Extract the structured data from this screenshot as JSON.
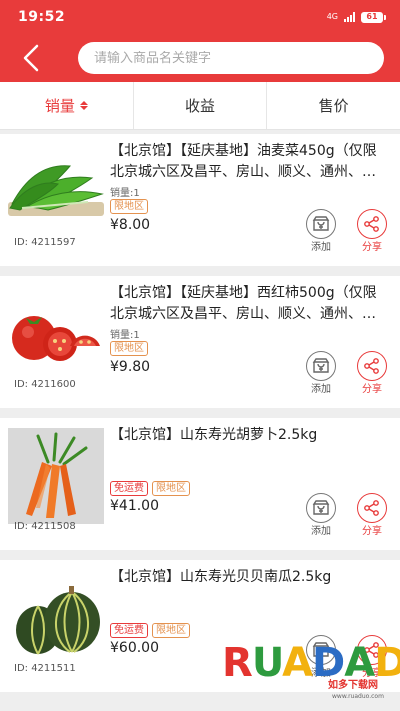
{
  "status_bar": {
    "time": "19:52",
    "network": "4G",
    "battery": "61"
  },
  "header": {
    "search_placeholder": "请输入商品名关键字"
  },
  "sort_tabs": [
    {
      "label": "销量",
      "active": true
    },
    {
      "label": "收益",
      "active": false
    },
    {
      "label": "售价",
      "active": false
    }
  ],
  "products": [
    {
      "title": "【北京馆】【延庆基地】油麦菜450g（仅限北京城六区及昌平、房山、顺义、通州、…",
      "sales": "销量:1",
      "tags": [
        "限地区"
      ],
      "price": "¥8.00",
      "id": "ID: 4211597",
      "image": "lettuce",
      "add_label": "添加",
      "share_label": "分享"
    },
    {
      "title": "【北京馆】【延庆基地】西红柿500g（仅限北京城六区及昌平、房山、顺义、通州、…",
      "sales": "销量:1",
      "tags": [
        "限地区"
      ],
      "price": "¥9.80",
      "id": "ID: 4211600",
      "image": "tomato",
      "add_label": "添加",
      "share_label": "分享"
    },
    {
      "title": "【北京馆】山东寿光胡萝卜2.5kg",
      "sales": "",
      "tags": [
        "免运费",
        "限地区"
      ],
      "price": "¥41.00",
      "id": "ID: 4211508",
      "image": "carrot",
      "add_label": "添加",
      "share_label": "分享"
    },
    {
      "title": "【北京馆】山东寿光贝贝南瓜2.5kg",
      "sales": "",
      "tags": [
        "免运费",
        "限地区"
      ],
      "price": "¥60.00",
      "id": "ID: 4211511",
      "image": "pumpkin",
      "add_label": "添加",
      "share_label": "分享"
    }
  ],
  "watermark": {
    "brand": "RUANDADO",
    "cn": "如多下载网",
    "url": "www.ruaduo.com"
  },
  "colors": {
    "primary": "#e83b3b",
    "region_tag": "#e4924f",
    "background": "#eeeeee"
  },
  "icons": [
    "back-chevron-icon",
    "sort-arrows-icon",
    "add-to-shop-icon",
    "share-icon",
    "battery-icon",
    "signal-icon"
  ]
}
